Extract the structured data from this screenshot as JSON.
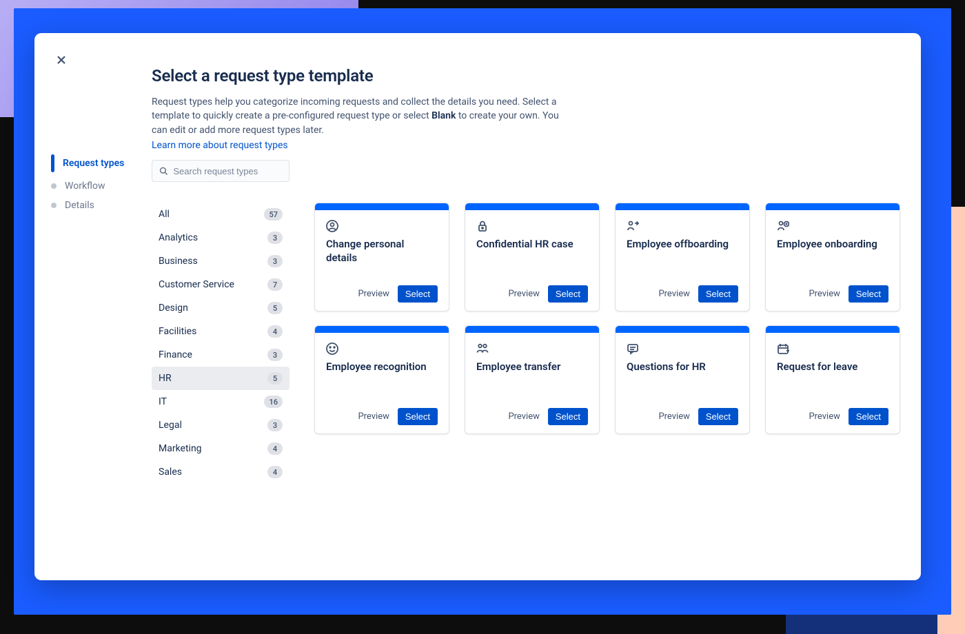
{
  "header": {
    "title": "Select a request type template",
    "desc_prefix": "Request types help you categorize incoming requests and collect the details you need. Select a template to quickly create a pre-configured request type or select ",
    "desc_bold": "Blank",
    "desc_suffix": " to create your own. You can edit or add more request types later.",
    "link": "Learn more about request types"
  },
  "steps": {
    "request_types": "Request types",
    "workflow": "Workflow",
    "details": "Details"
  },
  "search": {
    "placeholder": "Search request types"
  },
  "categories": [
    {
      "label": "All",
      "count": "57",
      "selected": false
    },
    {
      "label": "Analytics",
      "count": "3",
      "selected": false
    },
    {
      "label": "Business",
      "count": "3",
      "selected": false
    },
    {
      "label": "Customer Service",
      "count": "7",
      "selected": false
    },
    {
      "label": "Design",
      "count": "5",
      "selected": false
    },
    {
      "label": "Facilities",
      "count": "4",
      "selected": false
    },
    {
      "label": "Finance",
      "count": "3",
      "selected": false
    },
    {
      "label": "HR",
      "count": "5",
      "selected": true
    },
    {
      "label": "IT",
      "count": "16",
      "selected": false
    },
    {
      "label": "Legal",
      "count": "3",
      "selected": false
    },
    {
      "label": "Marketing",
      "count": "4",
      "selected": false
    },
    {
      "label": "Sales",
      "count": "4",
      "selected": false
    }
  ],
  "card_labels": {
    "preview": "Preview",
    "select": "Select"
  },
  "cards": [
    {
      "title": "Change personal details",
      "icon": "person-circle-icon"
    },
    {
      "title": "Confidential HR case",
      "icon": "lock-icon"
    },
    {
      "title": "Employee offboarding",
      "icon": "person-arrow-right-icon"
    },
    {
      "title": "Employee onboarding",
      "icon": "person-circle-arrow-icon"
    },
    {
      "title": "Employee recognition",
      "icon": "smile-icon"
    },
    {
      "title": "Employee transfer",
      "icon": "people-icon"
    },
    {
      "title": "Questions for HR",
      "icon": "chat-icon"
    },
    {
      "title": "Request for leave",
      "icon": "calendar-plus-icon"
    }
  ]
}
